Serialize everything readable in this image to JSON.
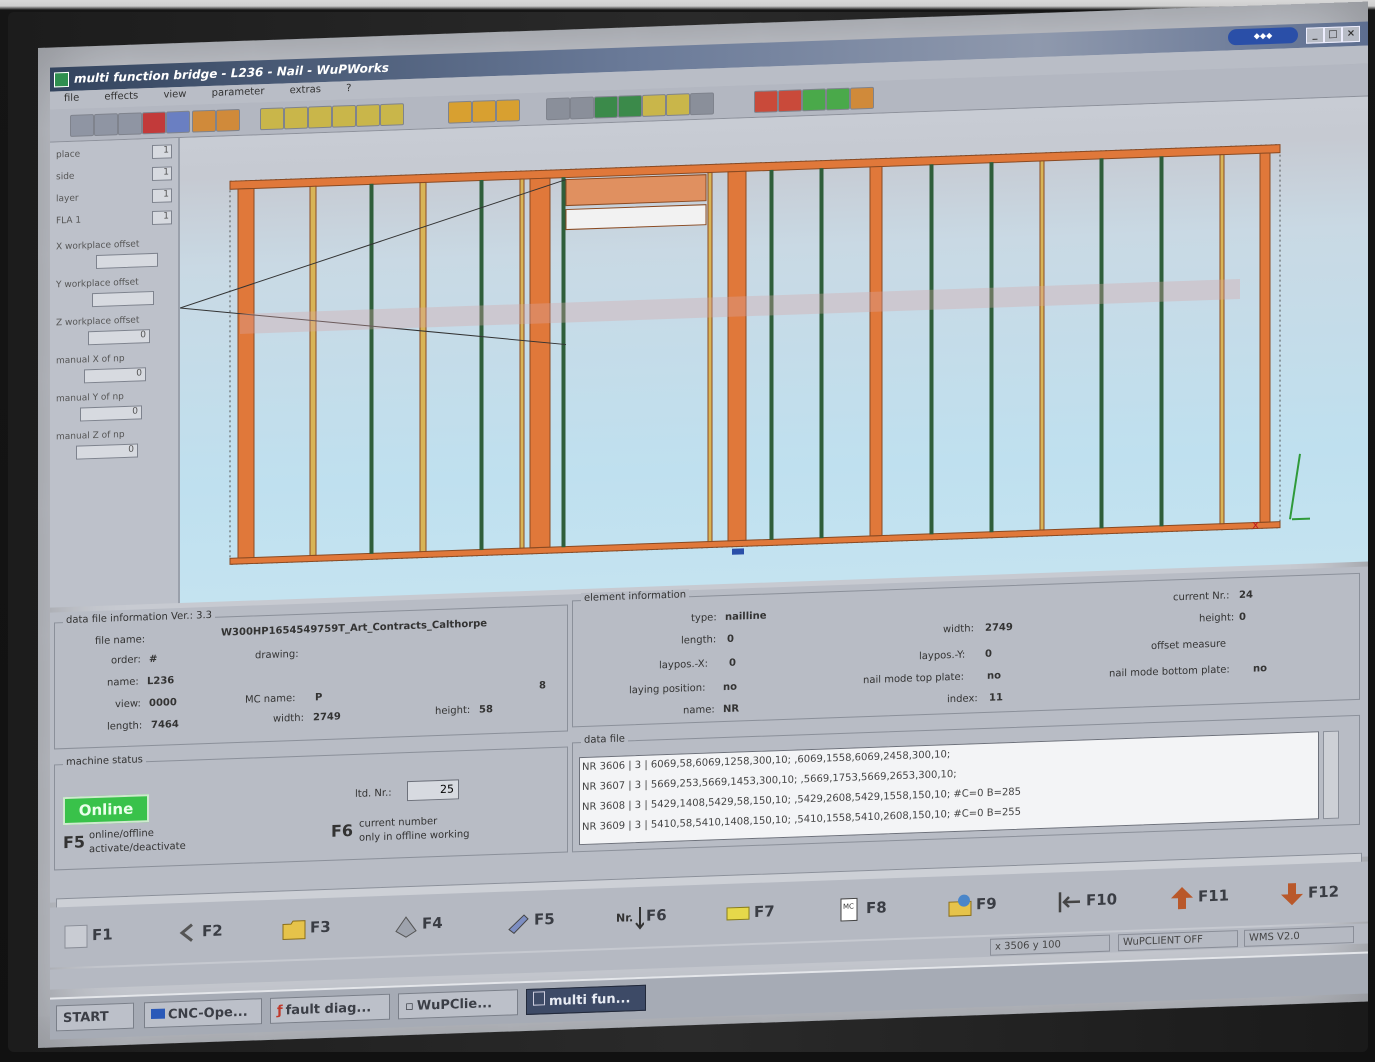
{
  "window": {
    "title": "multi function bridge - L236 - Nail - WuPWorks",
    "menus": [
      "file",
      "effects",
      "view",
      "parameter",
      "extras",
      "?"
    ]
  },
  "left_panel": {
    "fields": [
      {
        "label": "place",
        "value": "1"
      },
      {
        "label": "side",
        "value": "1"
      },
      {
        "label": "layer",
        "value": "1"
      },
      {
        "label": "FLA 1",
        "value": "1"
      }
    ],
    "offsets": [
      {
        "label": "X workplace offset",
        "value": ""
      },
      {
        "label": "Y workplace offset",
        "value": ""
      },
      {
        "label": "Z workplace offset",
        "value": "0"
      },
      {
        "label": "manual X of np",
        "value": "0"
      },
      {
        "label": "manual Y of np",
        "value": "0"
      },
      {
        "label": "manual Z of np",
        "value": "0"
      }
    ]
  },
  "data_file_info": {
    "title": "data file information Ver.: 3.3",
    "file_name_label": "file name:",
    "file_name": "W300HP1654549759T_Art_Contracts_Calthorpe",
    "order_label": "order:",
    "order": "#",
    "name_label": "name:",
    "name": "L236",
    "view_label": "view:",
    "view": "0000",
    "length_label": "length:",
    "length": "7464",
    "drawing_label": "drawing:",
    "mc_name_label": "MC name:",
    "mc_name": "P",
    "width_label": "width:",
    "width": "2749",
    "height_label": "height:",
    "height": "58",
    "extra": "8"
  },
  "element_info": {
    "title": "element information",
    "type_label": "type:",
    "type": "nailline",
    "length_label": "length:",
    "length": "0",
    "laypos_x_label": "laypos.-X:",
    "laypos_x": "0",
    "laying_position_label": "laying position:",
    "laying_position": "no",
    "name_label": "name:",
    "name": "NR",
    "width_label": "width:",
    "width": "2749",
    "laypos_y_label": "laypos.-Y:",
    "laypos_y": "0",
    "nail_top_label": "nail mode top plate:",
    "nail_top": "no",
    "index_label": "index:",
    "index": "11",
    "current_nr_label": "current Nr.:",
    "current_nr": "24",
    "height_label": "height:",
    "height": "0",
    "offset_label": "offset measure",
    "nail_bottom_label": "nail mode bottom plate:",
    "nail_bottom": "no"
  },
  "machine_status": {
    "title": "machine status",
    "status": "Online",
    "f5_key": "F5",
    "f5_text1": "online/offline",
    "f5_text2": "activate/deactivate",
    "ltd_label": "ltd. Nr.:",
    "ltd_value": "25",
    "f6_key": "F6",
    "f6_text1": "current number",
    "f6_text2": "only in offline working"
  },
  "data_file": {
    "title": "data file",
    "lines": [
      "NR 3606 | 3 | 6069,58,6069,1258,300,10; ,6069,1558,6069,2458,300,10;",
      "NR 3607 | 3 | 5669,253,5669,1453,300,10; ,5669,1753,5669,2653,300,10;",
      "NR 3608 | 3 | 5429,1408,5429,58,150,10; ,5429,2608,5429,1558,150,10; #C=0 B=285",
      "NR 3609 | 3 | 5410,58,5410,1408,150,10; ,5410,1558,5410,2608,150,10; #C=0 B=255"
    ]
  },
  "function_keys": [
    {
      "key": "F1",
      "icon": "blank-icon"
    },
    {
      "key": "F2",
      "icon": "arrow-left-icon"
    },
    {
      "key": "F3",
      "icon": "folder-open-icon"
    },
    {
      "key": "F4",
      "icon": "machine-icon"
    },
    {
      "key": "F5",
      "icon": "tool-icon"
    },
    {
      "key": "F6",
      "icon": "nr-down-icon",
      "prefix": "Nr."
    },
    {
      "key": "F7",
      "icon": "label-icon"
    },
    {
      "key": "F8",
      "icon": "mc-file-icon"
    },
    {
      "key": "F9",
      "icon": "folder-globe-icon"
    },
    {
      "key": "F10",
      "icon": "first-arrow-icon"
    },
    {
      "key": "F11",
      "icon": "arrow-up-icon"
    },
    {
      "key": "F12",
      "icon": "arrow-down-icon"
    }
  ],
  "status_bar": {
    "coords": "x 3506 y 100",
    "client": "WuPCLIENT OFF",
    "version": "WMS V2.0"
  },
  "taskbar": {
    "start": "START",
    "tasks": [
      {
        "label": "CNC-Ope...",
        "active": false
      },
      {
        "label": "fault diag...",
        "active": false
      },
      {
        "label": "WuPClie...",
        "active": false
      },
      {
        "label": "multi fun...",
        "active": true
      }
    ]
  },
  "colors": {
    "stud_orange": "#e0783a",
    "stud_yellow": "#d8b456",
    "nail_green": "#2f5e3a",
    "online_green": "#39c24a"
  }
}
